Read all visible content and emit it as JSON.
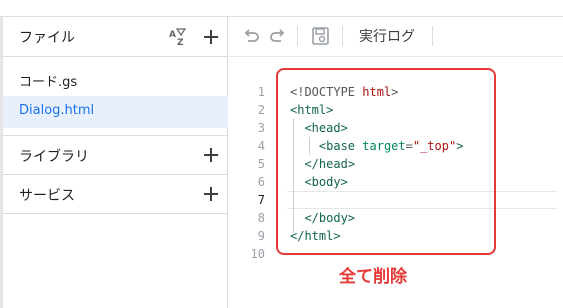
{
  "sidebar": {
    "title": "ファイル",
    "sort_icon": "sort-az-icon",
    "files": [
      {
        "name": "コード.gs",
        "active": false
      },
      {
        "name": "Dialog.html",
        "active": true
      }
    ],
    "sections": [
      {
        "label": "ライブラリ"
      },
      {
        "label": "サービス"
      }
    ]
  },
  "toolbar": {
    "undo_icon": "undo-icon",
    "redo_icon": "redo-icon",
    "save_icon": "save-icon",
    "exec_log_label": "実行ログ"
  },
  "editor": {
    "line_numbers": [
      "1",
      "2",
      "3",
      "4",
      "5",
      "6",
      "7",
      "8",
      "9",
      "10"
    ],
    "lines": [
      "<!DOCTYPE html>",
      "<html>",
      "  <head>",
      "    <base target=\"_top\">",
      "  </head>",
      "  <body>",
      "",
      "  </body>",
      "</html>",
      ""
    ]
  },
  "annotation": {
    "text": "全て削除",
    "color": "#e53935"
  },
  "colors": {
    "accent": "#1a73e8",
    "active_bg": "#e8f0fe",
    "annotation_red": "#e53935"
  }
}
